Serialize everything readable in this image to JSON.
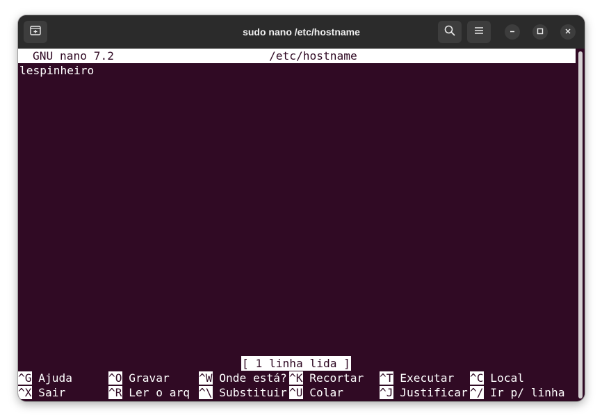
{
  "window": {
    "title": "sudo nano /etc/hostname",
    "icons": [
      "new-tab-icon",
      "search-icon",
      "hamburger-menu-icon",
      "minimize-icon",
      "maximize-icon",
      "close-icon"
    ]
  },
  "nano": {
    "version": "GNU nano 7.2",
    "filename": "/etc/hostname",
    "content": [
      "lespinheiro"
    ],
    "status": "[ 1 linha lida ]",
    "shortcuts_row1": [
      {
        "key": "^G",
        "label": "Ajuda"
      },
      {
        "key": "^O",
        "label": "Gravar"
      },
      {
        "key": "^W",
        "label": "Onde está?"
      },
      {
        "key": "^K",
        "label": "Recortar"
      },
      {
        "key": "^T",
        "label": "Executar"
      },
      {
        "key": "^C",
        "label": "Local"
      }
    ],
    "shortcuts_row2": [
      {
        "key": "^X",
        "label": "Sair"
      },
      {
        "key": "^R",
        "label": "Ler o arq"
      },
      {
        "key": "^\\",
        "label": "Substituir"
      },
      {
        "key": "^U",
        "label": "Colar"
      },
      {
        "key": "^J",
        "label": "Justificar"
      },
      {
        "key": "^/",
        "label": "Ir p/ linha"
      }
    ]
  },
  "colors": {
    "terminal_bg": "#300a24",
    "titlebar_bg": "#2b2b2b",
    "text": "#ffffff"
  }
}
